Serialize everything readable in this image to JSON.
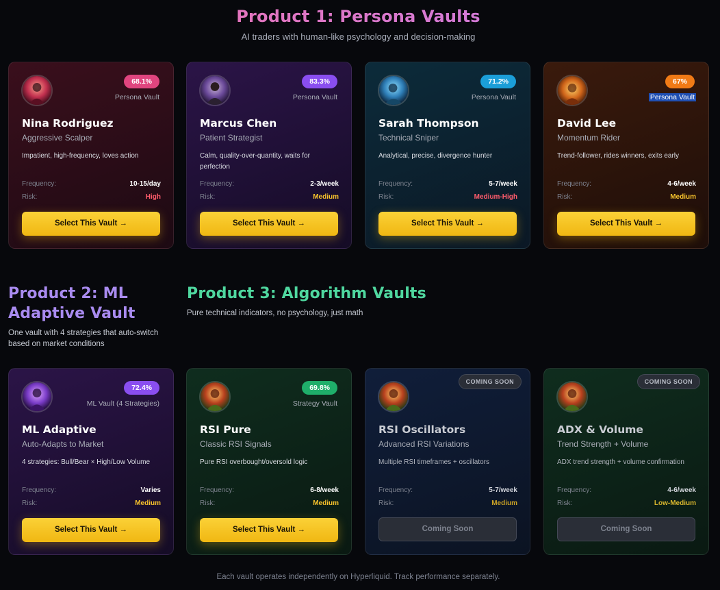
{
  "product1": {
    "title": "Product 1: Persona Vaults",
    "subtitle": "AI traders with human-like psychology and decision-making"
  },
  "product2": {
    "title": "Product 2: ML Adaptive Vault",
    "subtitle": "One vault with 4 strategies that auto-switch based on market conditions"
  },
  "product3": {
    "title": "Product 3: Algorithm Vaults",
    "subtitle": "Pure technical indicators, no psychology, just math"
  },
  "labels": {
    "frequency": "Frequency:",
    "risk": "Risk:",
    "select": "Select This Vault →",
    "coming_soon": "Coming Soon",
    "coming_soon_badge": "COMING SOON"
  },
  "cards": [
    {
      "name": "Nina Rodriguez",
      "role": "Aggressive Scalper",
      "desc": "Impatient, high-frequency, loves action",
      "pct": "68.1%",
      "type": "Persona Vault",
      "frequency": "10-15/day",
      "risk": "High",
      "theme": "red",
      "badge_color": "#e0457f",
      "risk_color": "#ff5c6c",
      "avatar_color": "#c2304f"
    },
    {
      "name": "Marcus Chen",
      "role": "Patient Strategist",
      "desc": "Calm, quality-over-quantity, waits for perfection",
      "pct": "83.3%",
      "type": "Persona Vault",
      "frequency": "2-3/week",
      "risk": "Medium",
      "theme": "purple",
      "badge_color": "#8a4ef0",
      "risk_color": "#f6c12c",
      "avatar_color": "#6b4a9a"
    },
    {
      "name": "Sarah Thompson",
      "role": "Technical Sniper",
      "desc": "Analytical, precise, divergence hunter",
      "pct": "71.2%",
      "type": "Persona Vault",
      "frequency": "5-7/week",
      "risk": "Medium-High",
      "theme": "teal",
      "badge_color": "#1b9ed8",
      "risk_color": "#ff5c6c",
      "avatar_color": "#2f7fb8"
    },
    {
      "name": "David Lee",
      "role": "Momentum Rider",
      "desc": "Trend-follower, rides winners, exits early",
      "pct": "67%",
      "type": "Persona Vault",
      "frequency": "4-6/week",
      "risk": "Medium",
      "theme": "brown",
      "badge_color": "#f07a16",
      "risk_color": "#f6c12c",
      "avatar_color": "#d0651a"
    },
    {
      "name": "ML Adaptive",
      "role": "Auto-Adapts to Market",
      "desc": "4 strategies: Bull/Bear × High/Low Volume",
      "pct": "72.4%",
      "type": "ML Vault (4 Strategies)",
      "frequency": "Varies",
      "risk": "Medium",
      "theme": "purple",
      "badge_color": "#8a4ef0",
      "risk_color": "#f6c12c",
      "avatar_color": "#7a3cc8"
    },
    {
      "name": "RSI Pure",
      "role": "Classic RSI Signals",
      "desc": "Pure RSI overbought/oversold logic",
      "pct": "69.8%",
      "type": "Strategy Vault",
      "frequency": "6-8/week",
      "risk": "Medium",
      "theme": "green",
      "badge_color": "#1fae6a",
      "risk_color": "#f6c12c",
      "avatar_color": "#b8401e"
    },
    {
      "name": "RSI Oscillators",
      "role": "Advanced RSI Variations",
      "desc": "Multiple RSI timeframes + oscillators",
      "frequency": "5-7/week",
      "risk": "Medium",
      "theme": "navy",
      "risk_color": "#c9a125",
      "avatar_color": "#b8401e"
    },
    {
      "name": "ADX & Volume",
      "role": "Trend Strength + Volume",
      "desc": "ADX trend strength + volume confirmation",
      "frequency": "4-6/week",
      "risk": "Low-Medium",
      "theme": "green",
      "risk_color": "#d8b62e",
      "avatar_color": "#b8401e"
    }
  ],
  "footer": "Each vault operates independently on Hyperliquid. Track performance separately."
}
